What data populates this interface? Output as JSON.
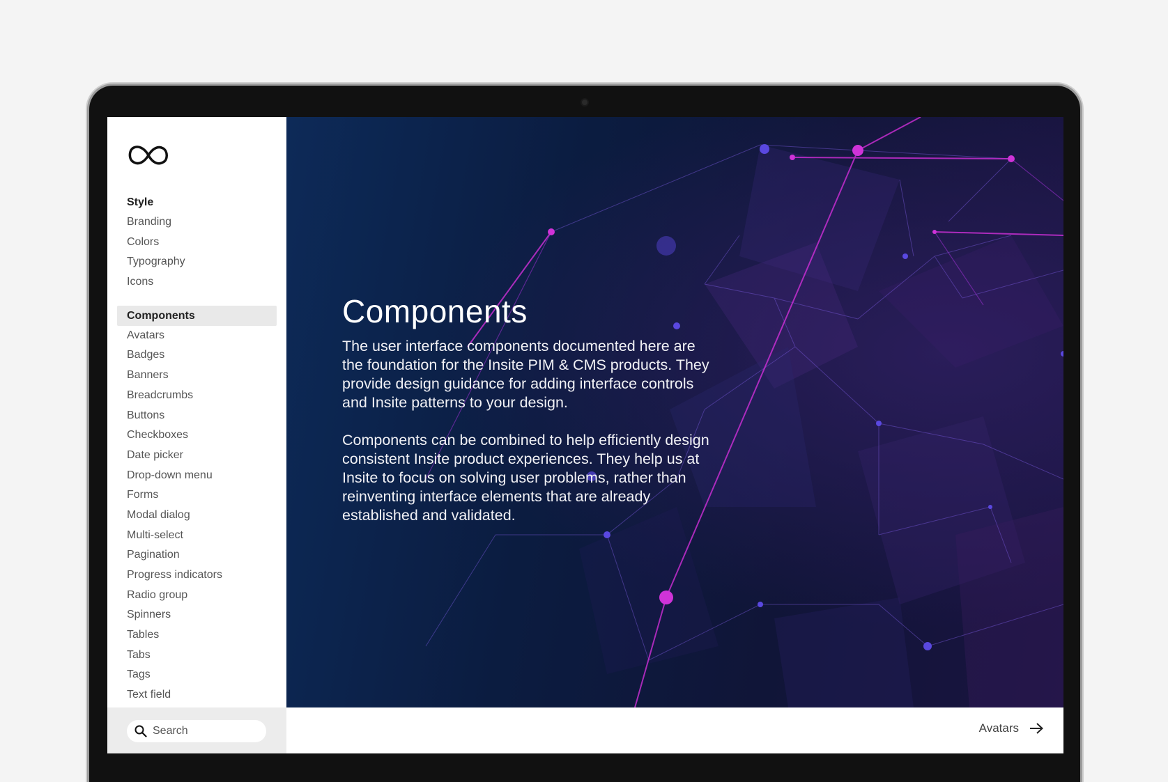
{
  "sidebar": {
    "logo_icon": "infinity-logo-icon",
    "groups": [
      {
        "heading": "Style",
        "items": [
          "Branding",
          "Colors",
          "Typography",
          "Icons"
        ]
      },
      {
        "heading": "Components",
        "active": true,
        "items": [
          "Avatars",
          "Badges",
          "Banners",
          "Breadcrumbs",
          "Buttons",
          "Checkboxes",
          "Date picker",
          "Drop-down menu",
          "Forms",
          "Modal dialog",
          "Multi-select",
          "Pagination",
          "Progress indicators",
          "Radio group",
          "Spinners",
          "Tables",
          "Tabs",
          "Tags",
          "Text field"
        ]
      }
    ],
    "search": {
      "placeholder": "Search",
      "icon": "search-icon"
    }
  },
  "hero": {
    "title": "Components",
    "paragraphs": [
      "The user interface components documented here are the foundation for the Insite PIM & CMS products. They provide design guidance for adding interface controls and Insite patterns to your design.",
      "Components can be combined to help efficiently design consistent Insite product experiences. They help us at Insite to focus on solving user problems, rather than reinventing interface elements that are already established and validated."
    ]
  },
  "footer": {
    "next_label": "Avatars",
    "next_icon": "arrow-right-icon"
  },
  "colors": {
    "hero_bg": "#0b1c40",
    "accent_magenta": "#c42bd6",
    "accent_purple": "#6a3bd0",
    "sidebar_active_bg": "#e9e9e9"
  }
}
